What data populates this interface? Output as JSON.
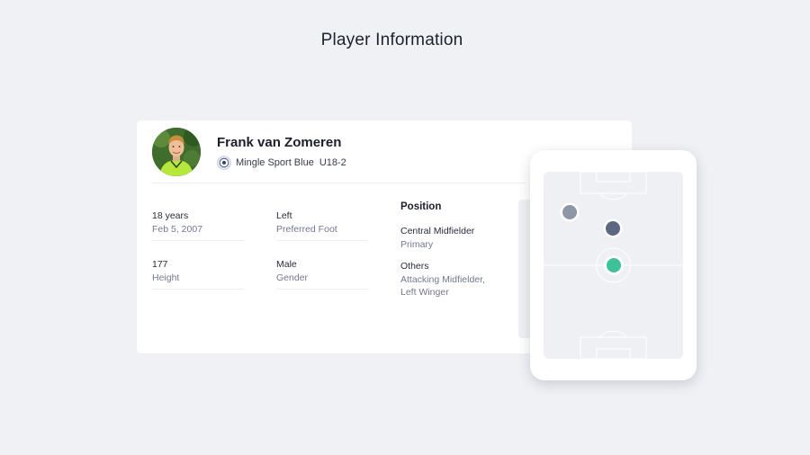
{
  "page": {
    "title": "Player Information"
  },
  "player": {
    "name": "Frank van Zomeren",
    "team": "Mingle Sport Blue",
    "squad": "U18-2",
    "avatar_icon": "player-photo",
    "team_logo_icon": "soccer-ball-crest-icon"
  },
  "stats": [
    {
      "value": "18 years",
      "label": "Feb 5, 2007"
    },
    {
      "value": "Left",
      "label": "Preferred Foot"
    },
    {
      "value": "177",
      "label": "Height"
    },
    {
      "value": "Male",
      "label": "Gender"
    }
  ],
  "position": {
    "heading": "Position",
    "primary_value": "Central Midfielder",
    "primary_label": "Primary",
    "others_title": "Others",
    "others_line1": "Attacking Midfielder,",
    "others_line2": "Left Winger"
  },
  "pitch": {
    "markers": [
      {
        "role": "Left Winger",
        "color": "#8d97a8",
        "type": "secondary"
      },
      {
        "role": "Attacking Midfielder",
        "color": "#5b6882",
        "type": "secondary"
      },
      {
        "role": "Central Midfielder",
        "color": "#3cc39a",
        "type": "primary"
      }
    ]
  },
  "colors": {
    "background": "#eff1f5",
    "primary_marker": "#3cc39a",
    "label_text": "#6f7a92"
  }
}
